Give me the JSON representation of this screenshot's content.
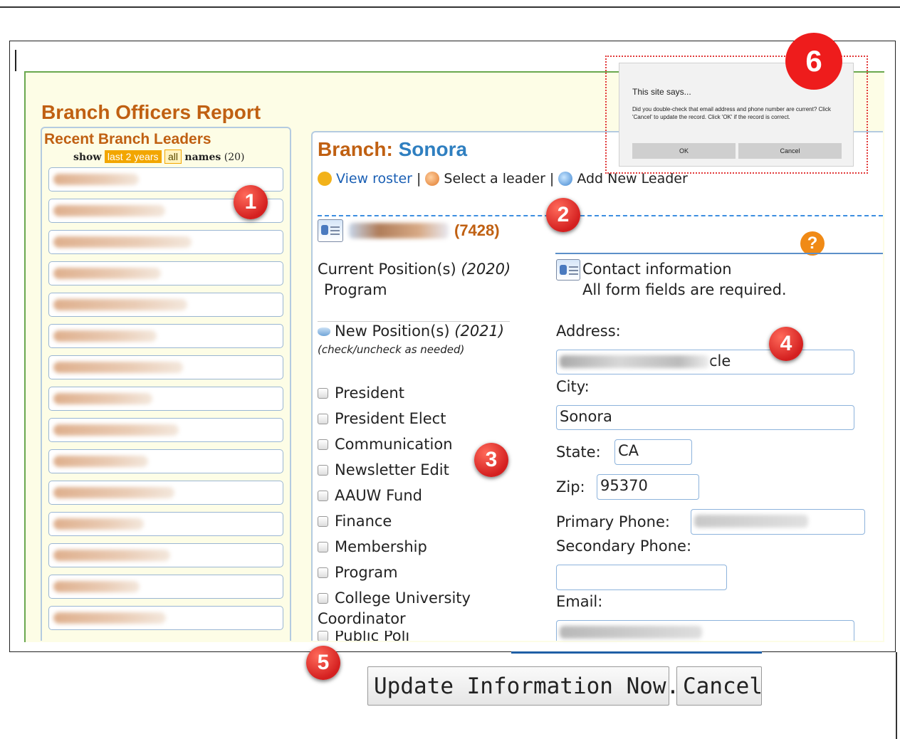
{
  "report": {
    "title": "Branch Officers Report"
  },
  "recent": {
    "title": "Recent Branch Leaders",
    "show_label": "show",
    "filter_active": "last 2 years",
    "filter_all": "all",
    "names_label": "names",
    "names_count": "(20)",
    "leaders_visible": 15
  },
  "branch": {
    "label": "Branch:",
    "name": "Sonora"
  },
  "toolbar": {
    "view_roster": "View roster",
    "sep1": "|",
    "select_leader": "Select a leader",
    "sep2": "|",
    "add_leader": "Add New Leader"
  },
  "person": {
    "id": "(7428)"
  },
  "current": {
    "label": "Current Position(s)",
    "year": "(2020)",
    "value": "Program"
  },
  "contact": {
    "title": "Contact information",
    "note": "All form fields are required."
  },
  "new_positions": {
    "label": "New Position(s)",
    "year": "(2021)",
    "hint": "(check/uncheck as needed)",
    "items": [
      "President",
      "President Elect",
      "Communication",
      "Newsletter Edit",
      "AAUW Fund",
      "Finance",
      "Membership",
      "Program",
      "College University",
      "Coordinator",
      "Public Poli"
    ]
  },
  "form": {
    "address_label": "Address:",
    "address_value_tail": "cle",
    "city_label": "City:",
    "city_value": "Sonora",
    "state_label": "State:",
    "state_value": "CA",
    "zip_label": "Zip:",
    "zip_value": "95370",
    "primary_phone_label": "Primary Phone:",
    "secondary_phone_label": "Secondary Phone:",
    "email_label": "Email:"
  },
  "buttons": {
    "update": "Update Information Now.",
    "cancel": "Cancel"
  },
  "dialog": {
    "title": "This site says...",
    "message": "Did you double-check that email address and phone number are current? Click 'Cancel' to update the record. Click 'OK' if the record is correct.",
    "ok": "OK",
    "cancel": "Cancel"
  },
  "markers": [
    "1",
    "2",
    "3",
    "4",
    "5",
    "6"
  ],
  "colors": {
    "accent": "#c06012",
    "link": "#1a5fb4",
    "branch_name": "#2f7fc0",
    "marker": "#d42020",
    "filter_chip": "#f2a600"
  }
}
